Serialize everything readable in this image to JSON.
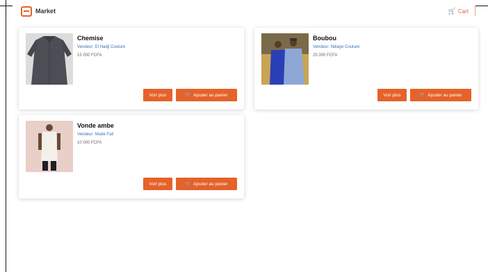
{
  "header": {
    "brand": "Market",
    "cart_label": "Cart",
    "logo_icon": "shop-logo-icon",
    "cart_icon": "cart-icon"
  },
  "accent_color": "#e5622a",
  "products": [
    {
      "title": "Chemise",
      "seller": "Vendeur: El Hadji Couture",
      "price": "15 000 FCFA",
      "view_label": "Voir plus",
      "add_label": "Ajouter au panier"
    },
    {
      "title": "Boubou",
      "seller": "Vendeur: Ndiaye Couture",
      "price": "25 000 FCFA",
      "view_label": "Voir plus",
      "add_label": "Ajouter au panier"
    },
    {
      "title": "Vonde ambe",
      "seller": "Vendeur: Mode Fall",
      "price": "10 000 FCFA",
      "view_label": "Voir plus",
      "add_label": "Ajouter au panier"
    }
  ]
}
